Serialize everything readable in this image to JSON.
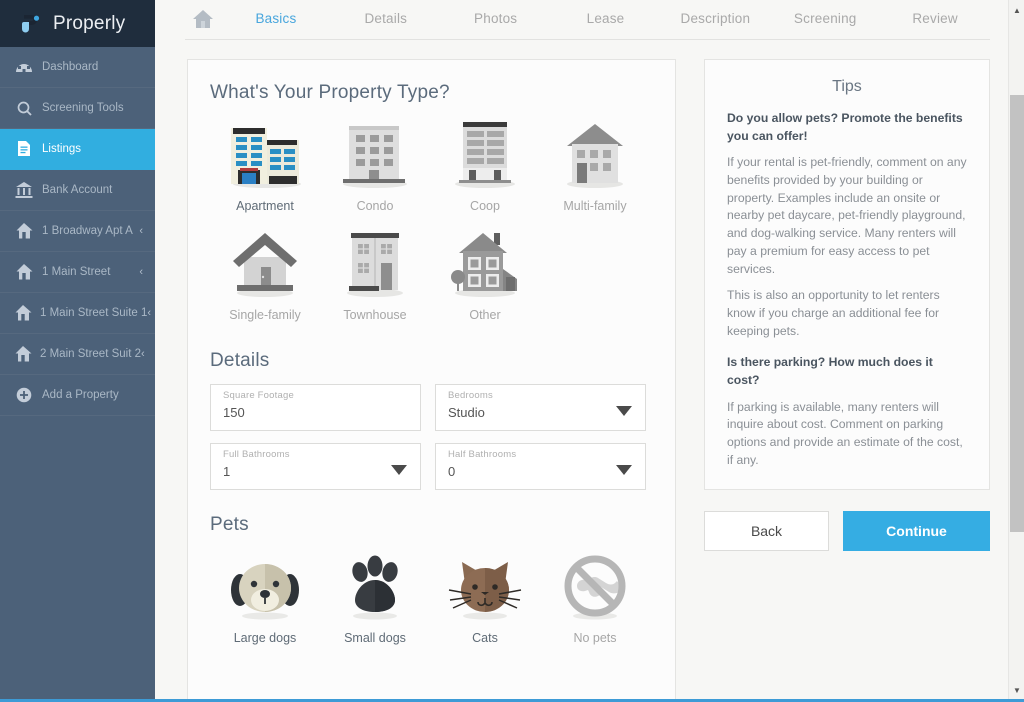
{
  "colors": {
    "accent": "#31aee0",
    "sidebar": "#4c6179",
    "brand_bar": "#1f2d3d",
    "continue": "#35ade3",
    "tab_active": "#48a6dd"
  },
  "sidebar": {
    "brand": "Properly",
    "brand_logo_icon": "properly-logo-icon",
    "items": [
      {
        "label": "Dashboard",
        "icon": "dashboard-icon",
        "active": false,
        "chevron": false
      },
      {
        "label": "Screening Tools",
        "icon": "search-icon",
        "active": false,
        "chevron": false
      },
      {
        "label": "Listings",
        "icon": "document-icon",
        "active": true,
        "chevron": false
      },
      {
        "label": "Bank Account",
        "icon": "bank-icon",
        "active": false,
        "chevron": false
      },
      {
        "label": "1 Broadway Apt A",
        "icon": "home-icon",
        "active": false,
        "chevron": true
      },
      {
        "label": "1 Main Street",
        "icon": "home-icon",
        "active": false,
        "chevron": true
      },
      {
        "label": "1 Main Street Suite 1",
        "icon": "home-icon",
        "active": false,
        "chevron": true
      },
      {
        "label": "2 Main Street Suit 2",
        "icon": "home-icon",
        "active": false,
        "chevron": true
      },
      {
        "label": "Add a Property",
        "icon": "plus-circle-icon",
        "active": false,
        "chevron": false
      }
    ]
  },
  "topnav": {
    "home_icon": "home-icon",
    "tabs": [
      {
        "label": "Basics",
        "active": true
      },
      {
        "label": "Details",
        "active": false
      },
      {
        "label": "Photos",
        "active": false
      },
      {
        "label": "Lease",
        "active": false
      },
      {
        "label": "Description",
        "active": false
      },
      {
        "label": "Screening",
        "active": false
      },
      {
        "label": "Review",
        "active": false
      }
    ]
  },
  "property_type": {
    "title": "What's Your Property Type?",
    "options": [
      {
        "label": "Apartment",
        "icon": "apartment-building-icon",
        "selected": true
      },
      {
        "label": "Condo",
        "icon": "condo-building-icon",
        "selected": false
      },
      {
        "label": "Coop",
        "icon": "coop-building-icon",
        "selected": false
      },
      {
        "label": "Multi-family",
        "icon": "multi-family-house-icon",
        "selected": false
      },
      {
        "label": "Single-family",
        "icon": "single-family-house-icon",
        "selected": false
      },
      {
        "label": "Townhouse",
        "icon": "townhouse-icon",
        "selected": false
      },
      {
        "label": "Other",
        "icon": "other-house-icon",
        "selected": false
      }
    ]
  },
  "details": {
    "title": "Details",
    "fields": [
      {
        "label": "Square Footage",
        "value": "150",
        "type": "text",
        "name": "square-footage-field"
      },
      {
        "label": "Bedrooms",
        "value": "Studio",
        "type": "select",
        "name": "bedrooms-select"
      },
      {
        "label": "Full Bathrooms",
        "value": "1",
        "type": "select",
        "name": "full-bathrooms-select"
      },
      {
        "label": "Half Bathrooms",
        "value": "0",
        "type": "select",
        "name": "half-bathrooms-select"
      }
    ]
  },
  "pets": {
    "title": "Pets",
    "options": [
      {
        "label": "Large dogs",
        "icon": "dog-face-icon",
        "selected": true
      },
      {
        "label": "Small dogs",
        "icon": "paw-print-icon",
        "selected": true
      },
      {
        "label": "Cats",
        "icon": "cat-face-icon",
        "selected": true
      },
      {
        "label": "No pets",
        "icon": "no-pets-icon",
        "selected": false
      }
    ]
  },
  "tips": {
    "heading": "Tips",
    "blocks": [
      {
        "style": "strong",
        "text": "Do you allow pets? Promote the benefits you can offer!"
      },
      {
        "style": "body",
        "text": "If your rental is pet-friendly, comment on any benefits provided by your building or property. Examples include an onsite or nearby pet daycare, pet-friendly playground, and dog-walking service. Many renters will pay a premium for easy access to pet services."
      },
      {
        "style": "body",
        "text": "This is also an opportunity to let renters know if you charge an additional fee for keeping pets."
      },
      {
        "style": "gap",
        "text": ""
      },
      {
        "style": "strong",
        "text": "Is there parking? How much does it cost?"
      },
      {
        "style": "body",
        "text": "If parking is available, many renters will inquire about cost. Comment on parking options and provide an estimate of the cost, if any."
      }
    ]
  },
  "buttons": {
    "back": "Back",
    "continue": "Continue"
  },
  "scrollbar": {
    "up_arrow": "▲",
    "down_arrow": "▼"
  }
}
